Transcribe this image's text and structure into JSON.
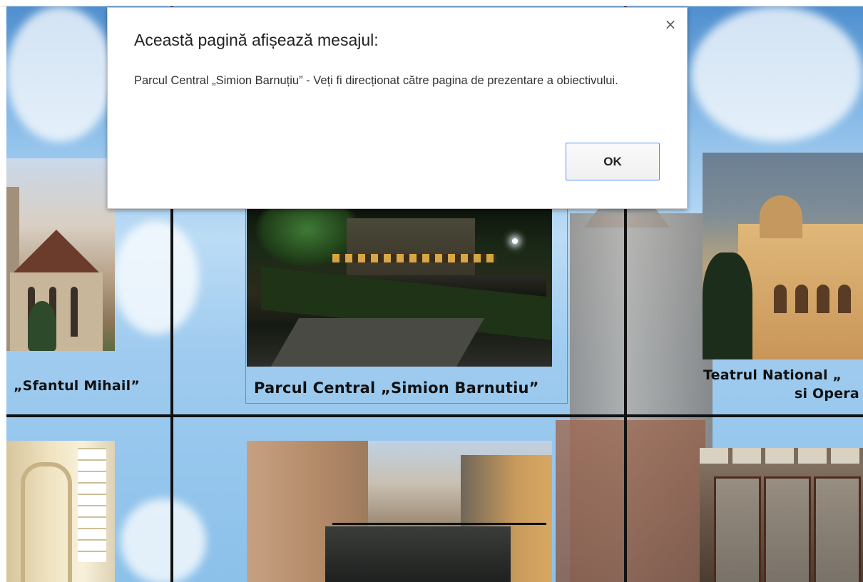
{
  "dialog": {
    "title": "Această pagină afișează mesajul:",
    "message": "Parcul Central „Simion Barnuțiu” - Veți fi direcționat către pagina de prezentare a obiectivului.",
    "ok_label": "OK",
    "close_icon": "×"
  },
  "tiles": {
    "mihail_caption": "„Sfantul Mihail”",
    "parc_caption": "Parcul Central „Simion Barnutiu”",
    "teatru_caption_line1": "Teatrul National „",
    "teatru_caption_line2": "si Opera R"
  },
  "colors": {
    "sky": "#8fc0ea",
    "grid_lines": "#111111",
    "ok_border": "#4d90fe",
    "park_frame": "#5b8bd8"
  }
}
